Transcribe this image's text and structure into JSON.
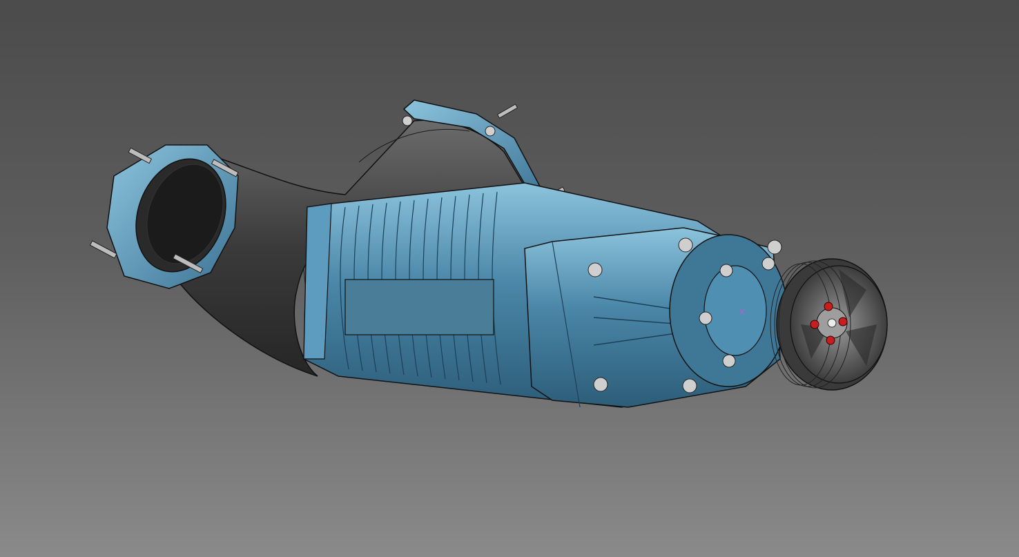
{
  "viewport": {
    "background_top": "#4b4b4b",
    "background_bottom": "#8a8a8a"
  },
  "model": {
    "body_color": "#4a86a8",
    "body_highlight": "#8cc3dc",
    "body_shadow": "#2c5d78",
    "intake_color": "#3a3a3a",
    "intake_highlight": "#6b6b6b",
    "pulley_color": "#5a5a5a",
    "bolt_color": "#cfcfcf",
    "pulley_bolt_color": "#c81e1e",
    "origin_marker_color": "#b060d0",
    "edge_color": "#111111"
  }
}
